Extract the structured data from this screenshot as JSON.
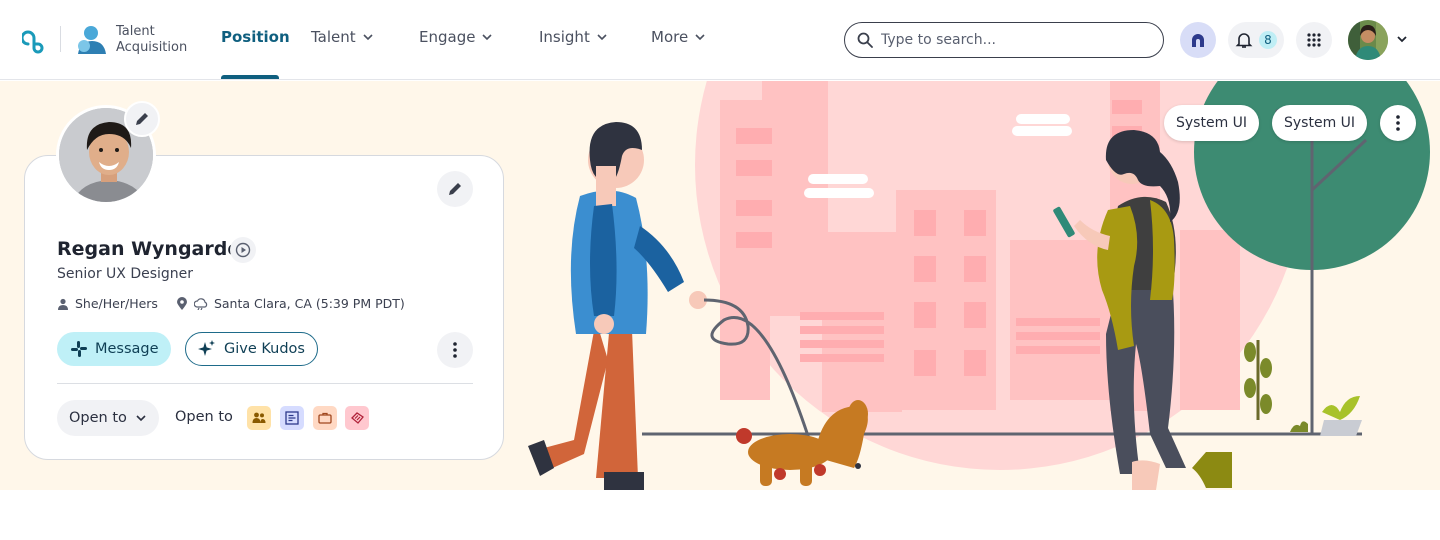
{
  "header": {
    "app_name": "Talent Acquisition",
    "nav": [
      {
        "label": "Position",
        "active": true
      },
      {
        "label": "Talent"
      },
      {
        "label": "Engage"
      },
      {
        "label": "Insight"
      },
      {
        "label": "More"
      }
    ],
    "search": {
      "placeholder": "Type to search..."
    },
    "notifications_count": "8",
    "icons": [
      "app-logo",
      "talent-acquisition-icon",
      "search-icon",
      "assistant-icon",
      "bell-icon",
      "apps-grid-icon",
      "user-avatar",
      "chevron-down-icon"
    ]
  },
  "banner": {
    "buttons": [
      "System UI",
      "System UI"
    ],
    "illustration": "person-walking-dog-and-woman-with-phone-in-city"
  },
  "profile": {
    "name": "Regan Wyngarde",
    "title": "Senior UX Designer",
    "pronouns": "She/Her/Hers",
    "location": "Santa Clara, CA (5:39 PM PDT)",
    "actions": {
      "message": "Message",
      "kudos": "Give Kudos"
    },
    "open_to_dropdown": "Open to",
    "open_to_label": "Open to",
    "open_to_icons": [
      "people-icon",
      "list-icon",
      "briefcase-icon",
      "ticket-icon"
    ]
  },
  "colors": {
    "accent": "#0f5f7f",
    "banner_bg": "#fff7ea",
    "message_bg": "#bff0f7"
  }
}
